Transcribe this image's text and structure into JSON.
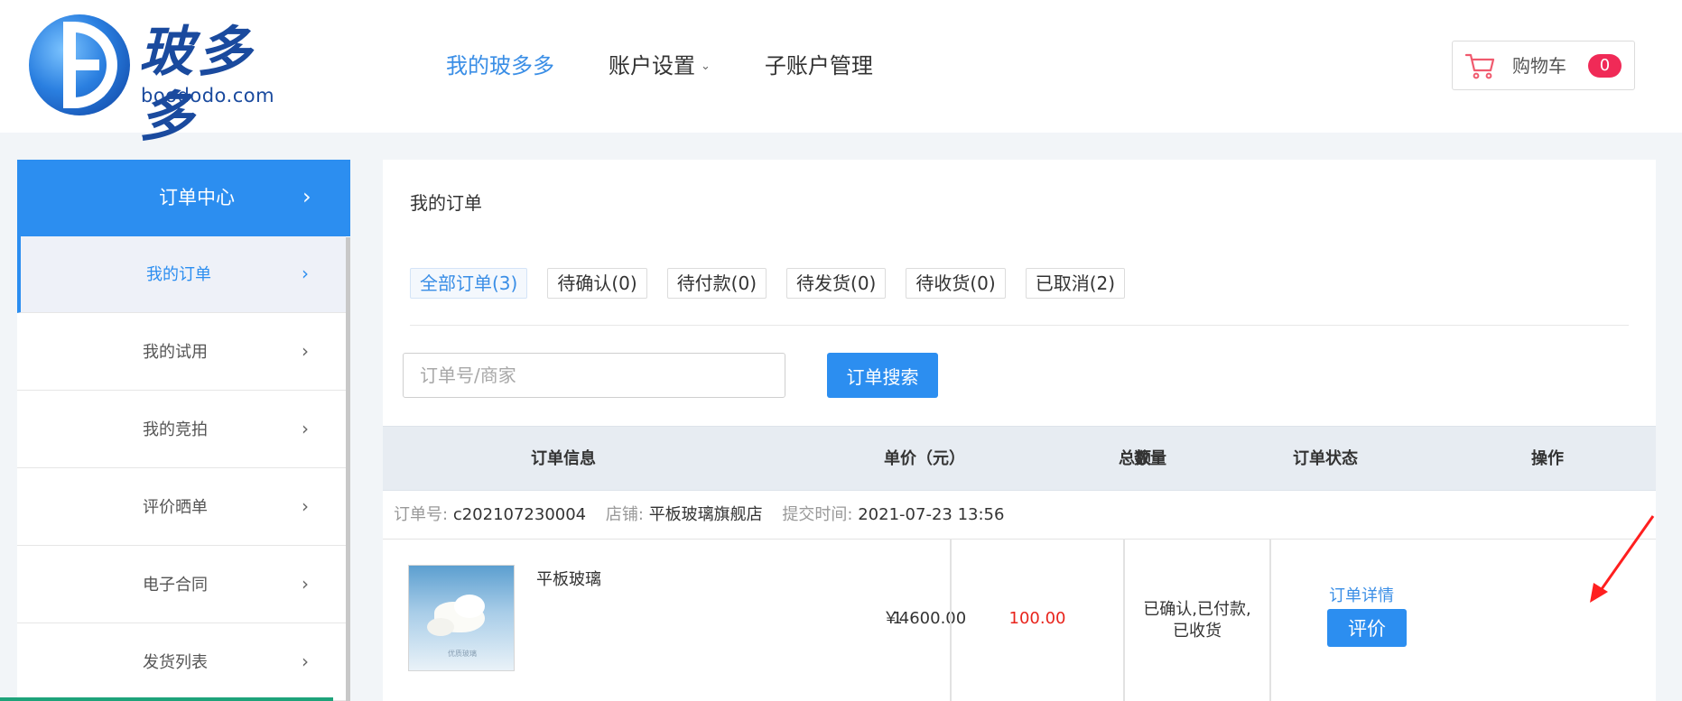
{
  "header": {
    "logo_cn": "玻多多",
    "logo_en": "boododo.com",
    "nav": [
      {
        "label": "我的玻多多",
        "active": true
      },
      {
        "label": "账户设置",
        "active": false
      },
      {
        "label": "子账户管理",
        "active": false
      }
    ],
    "cart": {
      "label": "购物车",
      "count": "0"
    }
  },
  "sidebar": {
    "header": "订单中心",
    "items": [
      {
        "label": "我的订单"
      },
      {
        "label": "我的试用"
      },
      {
        "label": "我的竞拍"
      },
      {
        "label": "评价晒单"
      },
      {
        "label": "电子合同"
      },
      {
        "label": "发货列表"
      }
    ]
  },
  "main": {
    "title": "我的订单",
    "tabs": [
      {
        "label": "全部订单(3)"
      },
      {
        "label": "待确认(0)"
      },
      {
        "label": "待付款(0)"
      },
      {
        "label": "待发货(0)"
      },
      {
        "label": "待收货(0)"
      },
      {
        "label": "已取消(2)"
      }
    ],
    "search": {
      "placeholder": "订单号/商家",
      "button": "订单搜索"
    },
    "table": {
      "columns": [
        "订单信息",
        "单价（元）",
        "数量",
        "总额",
        "订单状态",
        "操作"
      ]
    },
    "order": {
      "no_label": "订单号:",
      "no": "c202107230004",
      "shop_label": "店铺:",
      "shop": "平板玻璃旗舰店",
      "time_label": "提交时间:",
      "time": "2021-07-23 13:56",
      "product_name": "平板玻璃",
      "thumb_caption": "优质玻璃",
      "price": "￥4600.00",
      "qty": "1",
      "total": "100.00",
      "status": "已确认,已付款,已收货",
      "detail_link": "订单详情",
      "review_button": "评价"
    }
  },
  "colors": {
    "accent": "#2c8ef0",
    "price_red": "#e8241c",
    "badge": "#f02a57"
  }
}
